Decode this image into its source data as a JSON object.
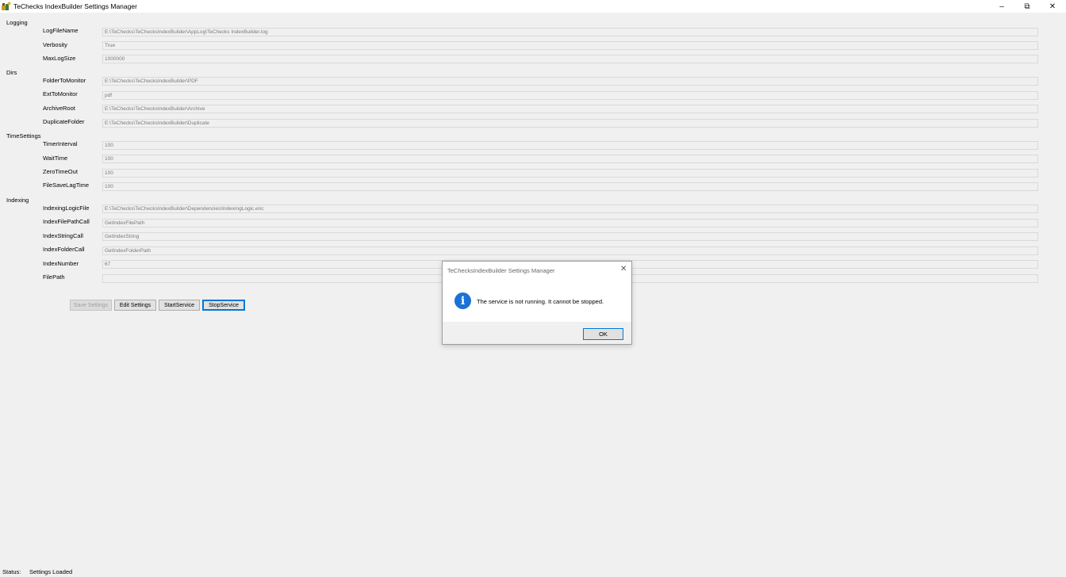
{
  "window": {
    "title": "TeChecks IndexBuilder Settings Manager",
    "icon": "app-builder-icon",
    "controls": {
      "minimize": "–",
      "restore": "⧉",
      "close": "✕"
    }
  },
  "groups": {
    "logging": "Logging",
    "dirs": "Dirs",
    "time": "TimeSettings",
    "indexing": "Indexing"
  },
  "fields": {
    "logfilename": {
      "label": "LogFileName",
      "value": "E:\\TeChecks\\TeChecksIndexBuilder\\AppLog\\TeChecks IndexBuilder.log"
    },
    "verbosity": {
      "label": "Verbosity",
      "value": "True"
    },
    "maxlogsize": {
      "label": "MaxLogSize",
      "value": "1000000"
    },
    "foldertomonitor": {
      "label": "FolderToMonitor",
      "value": "E:\\TeChecks\\TeChecksIndexBuilder\\PDF"
    },
    "exttomonitor": {
      "label": "ExtToMonitor",
      "value": "pdf"
    },
    "archiveroot": {
      "label": "ArchiveRoot",
      "value": "E:\\TeChecks\\TeChecksIndexBuilder\\Archive"
    },
    "duplicatefolder": {
      "label": "DuplicateFolder",
      "value": "E:\\TeChecks\\TeChecksIndexBuilder\\Duplicate"
    },
    "timerinterval": {
      "label": "TimerInterval",
      "value": "100"
    },
    "waittime": {
      "label": "WaitTime",
      "value": "100"
    },
    "zerotimeout": {
      "label": "ZeroTimeOut",
      "value": "100"
    },
    "filesavelagtime": {
      "label": "FileSaveLagTime",
      "value": "100"
    },
    "indexinglogicfile": {
      "label": "IndexingLogicFile",
      "value": "E:\\TeChecks\\TeChecksIndexBuilder\\Dependencies\\IndexingLogic.enc"
    },
    "indexfilepathcall": {
      "label": "IndexFilePathCall",
      "value": "GetIndexFilePath"
    },
    "indexstringcall": {
      "label": "IndexStringCall",
      "value": "GetIndexString"
    },
    "indexfoldercall": {
      "label": "IndexFolderCall",
      "value": "GetIndexFolderPath"
    },
    "indexnumber": {
      "label": "IndexNumber",
      "value": "67"
    },
    "filepath": {
      "label": "FilePath",
      "value": ""
    }
  },
  "buttons": {
    "save": "Save Settings",
    "edit": "Edit Settings",
    "start": "StartService",
    "stop": "StopService"
  },
  "status": {
    "label": "Status:",
    "value": "Settings Loaded"
  },
  "dialog": {
    "title": "TeChecksIndexBuilder Settings Manager",
    "message": "The service is not running. It cannot be stopped.",
    "ok": "OK",
    "close": "✕",
    "icon": "information-icon",
    "icon_glyph": "i"
  },
  "colors": {
    "accent": "#0078d7",
    "info_icon": "#1a72d6",
    "background": "#f0f0f0"
  }
}
